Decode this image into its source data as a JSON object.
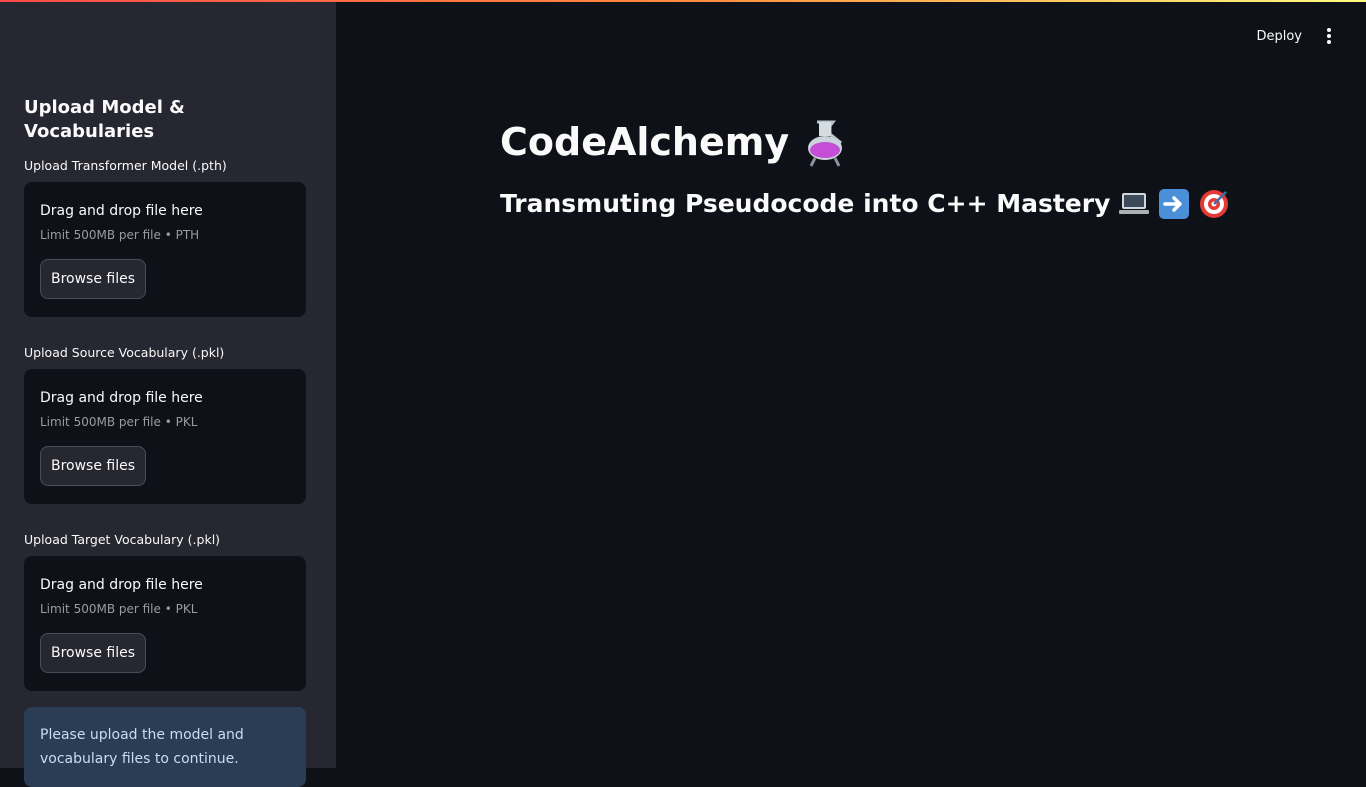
{
  "header": {
    "deploy_label": "Deploy",
    "menu_icon": "more-vertical-icon"
  },
  "sidebar": {
    "title": "Upload Model & Vocabularies",
    "uploaders": [
      {
        "label": "Upload Transformer Model (.pth)",
        "drop_text": "Drag and drop file here",
        "limit_text": "Limit 500MB per file • PTH",
        "button_label": "Browse files"
      },
      {
        "label": "Upload Source Vocabulary (.pkl)",
        "drop_text": "Drag and drop file here",
        "limit_text": "Limit 500MB per file • PKL",
        "button_label": "Browse files"
      },
      {
        "label": "Upload Target Vocabulary (.pkl)",
        "drop_text": "Drag and drop file here",
        "limit_text": "Limit 500MB per file • PKL",
        "button_label": "Browse files"
      }
    ],
    "info_message": "Please upload the model and vocabulary files to continue."
  },
  "main": {
    "title": "CodeAlchemy",
    "title_icon": "alembic-icon",
    "subtitle": "Transmuting Pseudocode into C++ Mastery",
    "subtitle_icons": [
      "laptop-icon",
      "right-arrow-icon",
      "target-icon"
    ]
  },
  "colors": {
    "background": "#0e1117",
    "sidebar": "#262730",
    "info_background": "#2a3d54",
    "accent_gradient_start": "#ff4b4b",
    "accent_gradient_end": "#fffd80"
  }
}
